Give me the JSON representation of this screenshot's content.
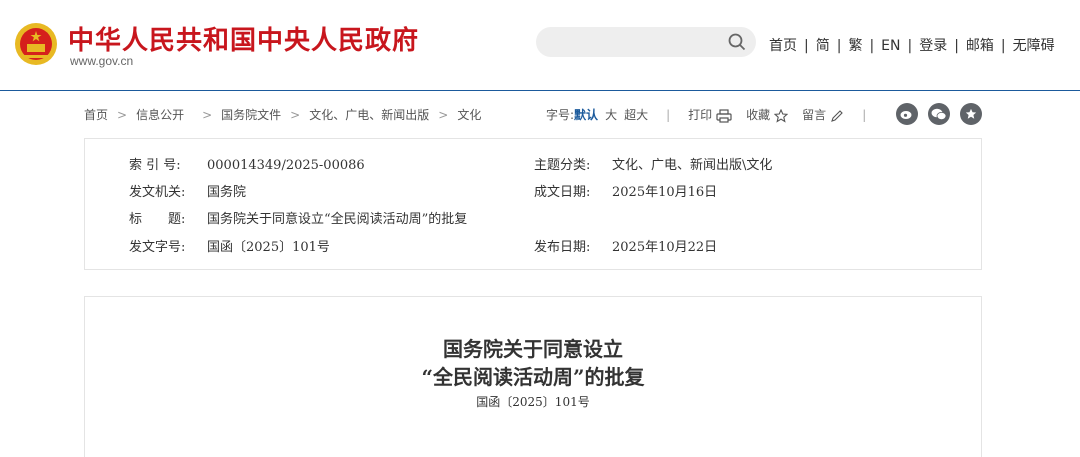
{
  "header": {
    "site_name": "中华人民共和国中央人民政府",
    "site_url": "www.gov.cn",
    "search_placeholder": "",
    "nav": [
      "首页",
      "简",
      "繁",
      "EN",
      "登录",
      "邮箱",
      "无障碍"
    ],
    "nav_separator": "|"
  },
  "breadcrumb": [
    "首页",
    "信息公开",
    "国务院文件",
    "文化、广电、新闻出版",
    "文化"
  ],
  "breadcrumb_separator": ">",
  "tools": {
    "font_label": "字号:",
    "font_default": "默认",
    "font_large": "大",
    "font_xlarge": "超大",
    "print": "打印",
    "favorite": "收藏",
    "comment": "留言"
  },
  "meta": {
    "index_label": "索 引 号:",
    "index_value": "000014349/2025-00086",
    "topic_label": "主题分类:",
    "topic_value": "文化、广电、新闻出版\\文化",
    "issuer_label": "发文机关:",
    "issuer_value": "国务院",
    "date_written_label": "成文日期:",
    "date_written_value": "2025年10月16日",
    "title_label": "标　　题:",
    "title_value": "国务院关于同意设立“全民阅读活动周”的批复",
    "docno_label": "发文字号:",
    "docno_value": "国函〔2025〕101号",
    "publish_label": "发布日期:",
    "publish_value": "2025年10月22日"
  },
  "article": {
    "title_line1": "国务院关于同意设立",
    "title_line2": "“全民阅读活动周”的批复",
    "doc_number": "国函〔2025〕101号"
  },
  "colors": {
    "brand_red": "#c8161d",
    "accent_blue": "#1b5a9c"
  }
}
